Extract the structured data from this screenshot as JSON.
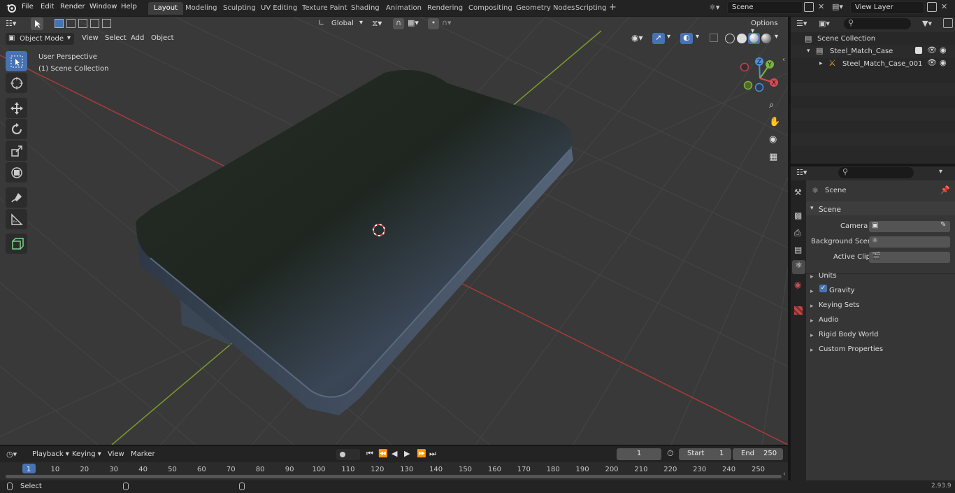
{
  "menu": [
    "File",
    "Edit",
    "Render",
    "Window",
    "Help"
  ],
  "workspace_tabs": [
    "Layout",
    "Modeling",
    "Sculpting",
    "UV Editing",
    "Texture Paint",
    "Shading",
    "Animation",
    "Rendering",
    "Compositing",
    "Geometry Nodes",
    "Scripting"
  ],
  "scene_field": "Scene",
  "view_layer_field": "View Layer",
  "viewport": {
    "transform_orientation": "Global",
    "options_label": "Options",
    "mode": "Object Mode",
    "header_menu": [
      "View",
      "Select",
      "Add",
      "Object"
    ],
    "overlay_line1": "User Perspective",
    "overlay_line2": "(1) Scene Collection",
    "gizmo_axes": {
      "z": "Z",
      "y": "Y",
      "x": "X"
    }
  },
  "outliner": {
    "root": "Scene Collection",
    "items": [
      "Steel_Match_Case",
      "Steel_Match_Case_001"
    ]
  },
  "properties": {
    "context_title": "Scene",
    "panel_title": "Scene",
    "fields": [
      "Camera",
      "Background Scene",
      "Active Clip"
    ],
    "panels": [
      "Units",
      "Gravity",
      "Keying Sets",
      "Audio",
      "Rigid Body World",
      "Custom Properties"
    ]
  },
  "timeline": {
    "menu": [
      "Playback",
      "Keying",
      "View",
      "Marker"
    ],
    "current_frame": "1",
    "start_label": "Start",
    "start_value": "1",
    "end_label": "End",
    "end_value": "250",
    "ticks": [
      "1",
      "10",
      "20",
      "30",
      "40",
      "50",
      "60",
      "70",
      "80",
      "90",
      "100",
      "110",
      "120",
      "130",
      "140",
      "150",
      "160",
      "170",
      "180",
      "190",
      "200",
      "210",
      "220",
      "230",
      "240",
      "250"
    ]
  },
  "status": {
    "left": "Select",
    "version": "2.93.9"
  }
}
